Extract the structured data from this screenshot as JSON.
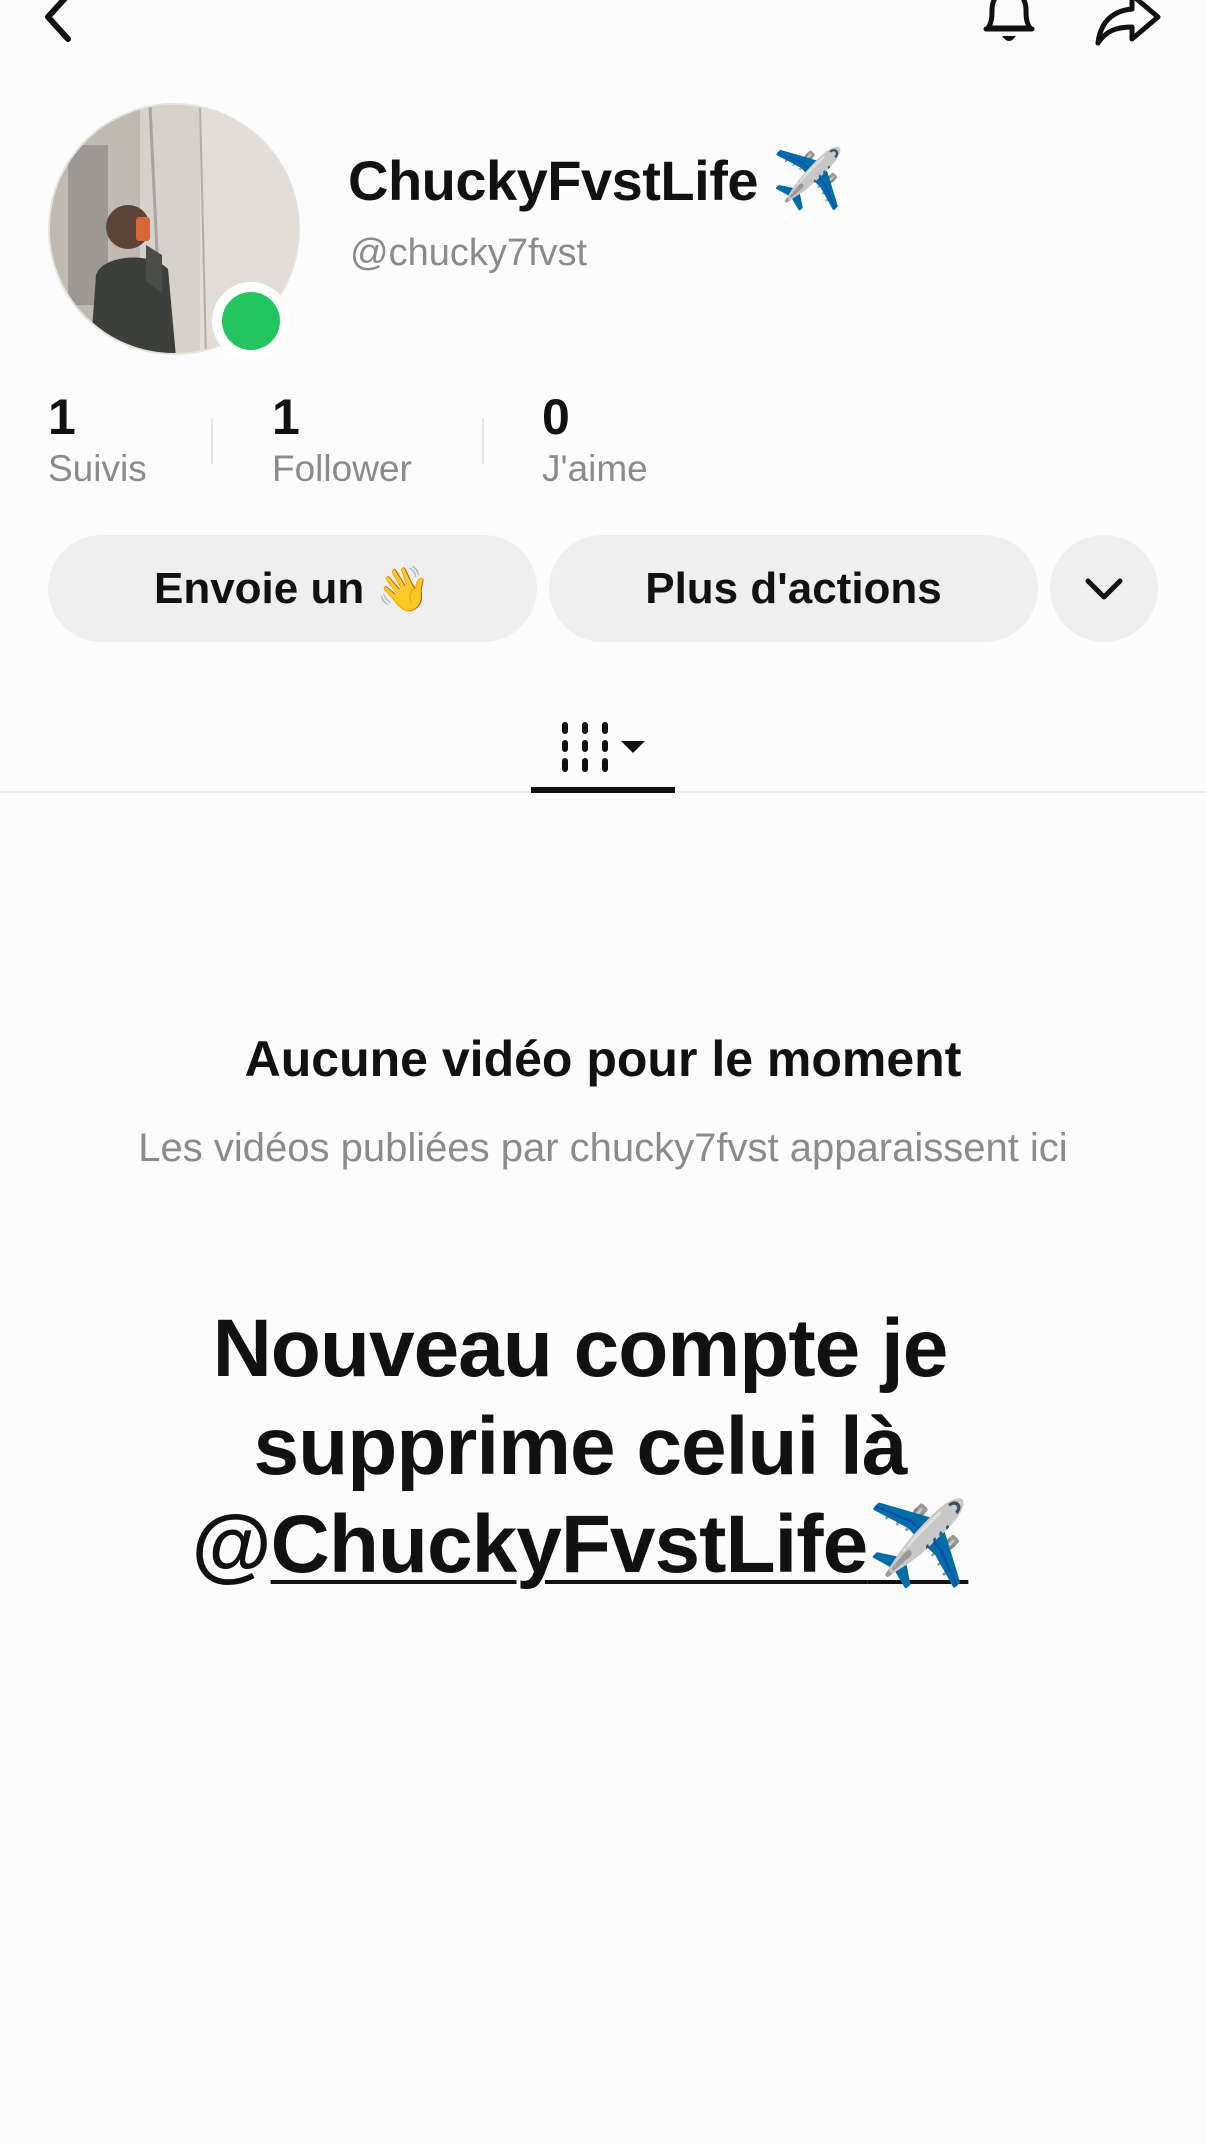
{
  "profile": {
    "display_name": "ChuckyFvstLife",
    "display_name_emoji": "✈️",
    "username": "@chucky7fvst",
    "online_status_color": "#22c55e"
  },
  "stats": [
    {
      "value": "1",
      "label": "Suivis"
    },
    {
      "value": "1",
      "label": "Follower"
    },
    {
      "value": "0",
      "label": "J'aime"
    }
  ],
  "actions": {
    "wave_label": "Envoie un",
    "wave_emoji": "👋",
    "more_label": "Plus d'actions"
  },
  "tabs": {
    "active_tab": "videos-grid"
  },
  "empty_state": {
    "title": "Aucune vidéo pour le moment",
    "subtitle": "Les vidéos publiées par chucky7fvst apparaissent ici"
  },
  "overlay_text": {
    "line1": "Nouveau compte je",
    "line2": "supprime celui là",
    "mention_at": "@",
    "mention_name": "ChuckyFvstLife",
    "mention_emoji": "✈️"
  },
  "icons": {
    "back": "chevron-left-icon",
    "bell": "bell-icon",
    "share": "share-arrow-icon",
    "chevron": "chevron-down-icon",
    "grid": "grid-columns-icon"
  }
}
